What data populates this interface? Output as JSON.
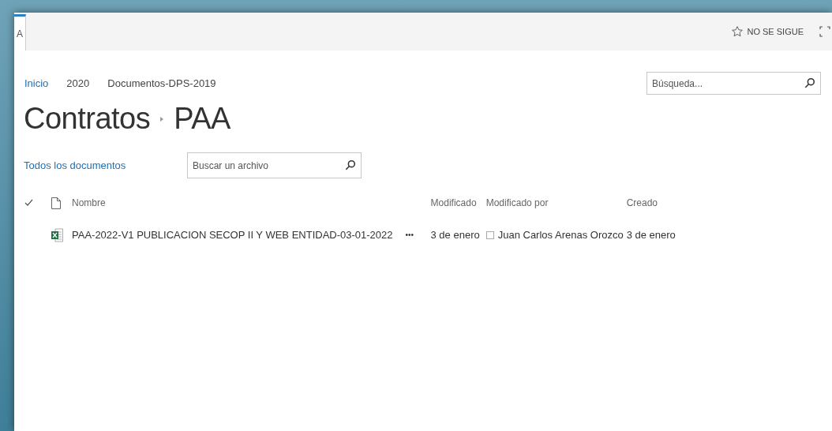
{
  "top_bar": {
    "tab": {
      "label": "A",
      "selected": true
    },
    "follow": {
      "label": "NO SE SIGUE"
    }
  },
  "breadcrumbs": [
    {
      "label": "Inicio",
      "selected": true
    },
    {
      "label": "2020",
      "selected": false
    },
    {
      "label": "Documentos-DPS-2019",
      "selected": false
    }
  ],
  "site_search": {
    "placeholder": "Búsqueda..."
  },
  "title": {
    "parts": [
      "Contratos",
      "PAA"
    ]
  },
  "view": {
    "label": "Todos los documentos"
  },
  "file_search": {
    "placeholder": "Buscar un archivo"
  },
  "table": {
    "columns": [
      "Nombre",
      "Modificado",
      "Modificado por",
      "Creado"
    ],
    "rows": [
      {
        "name": "PAA-2022-V1 PUBLICACION SECOP II Y WEB ENTIDAD-03-01-2022",
        "menu": "•••",
        "modified": "3 de enero",
        "modified_by": "Juan Carlos Arenas Orozco",
        "created": "3 de enero"
      }
    ]
  }
}
